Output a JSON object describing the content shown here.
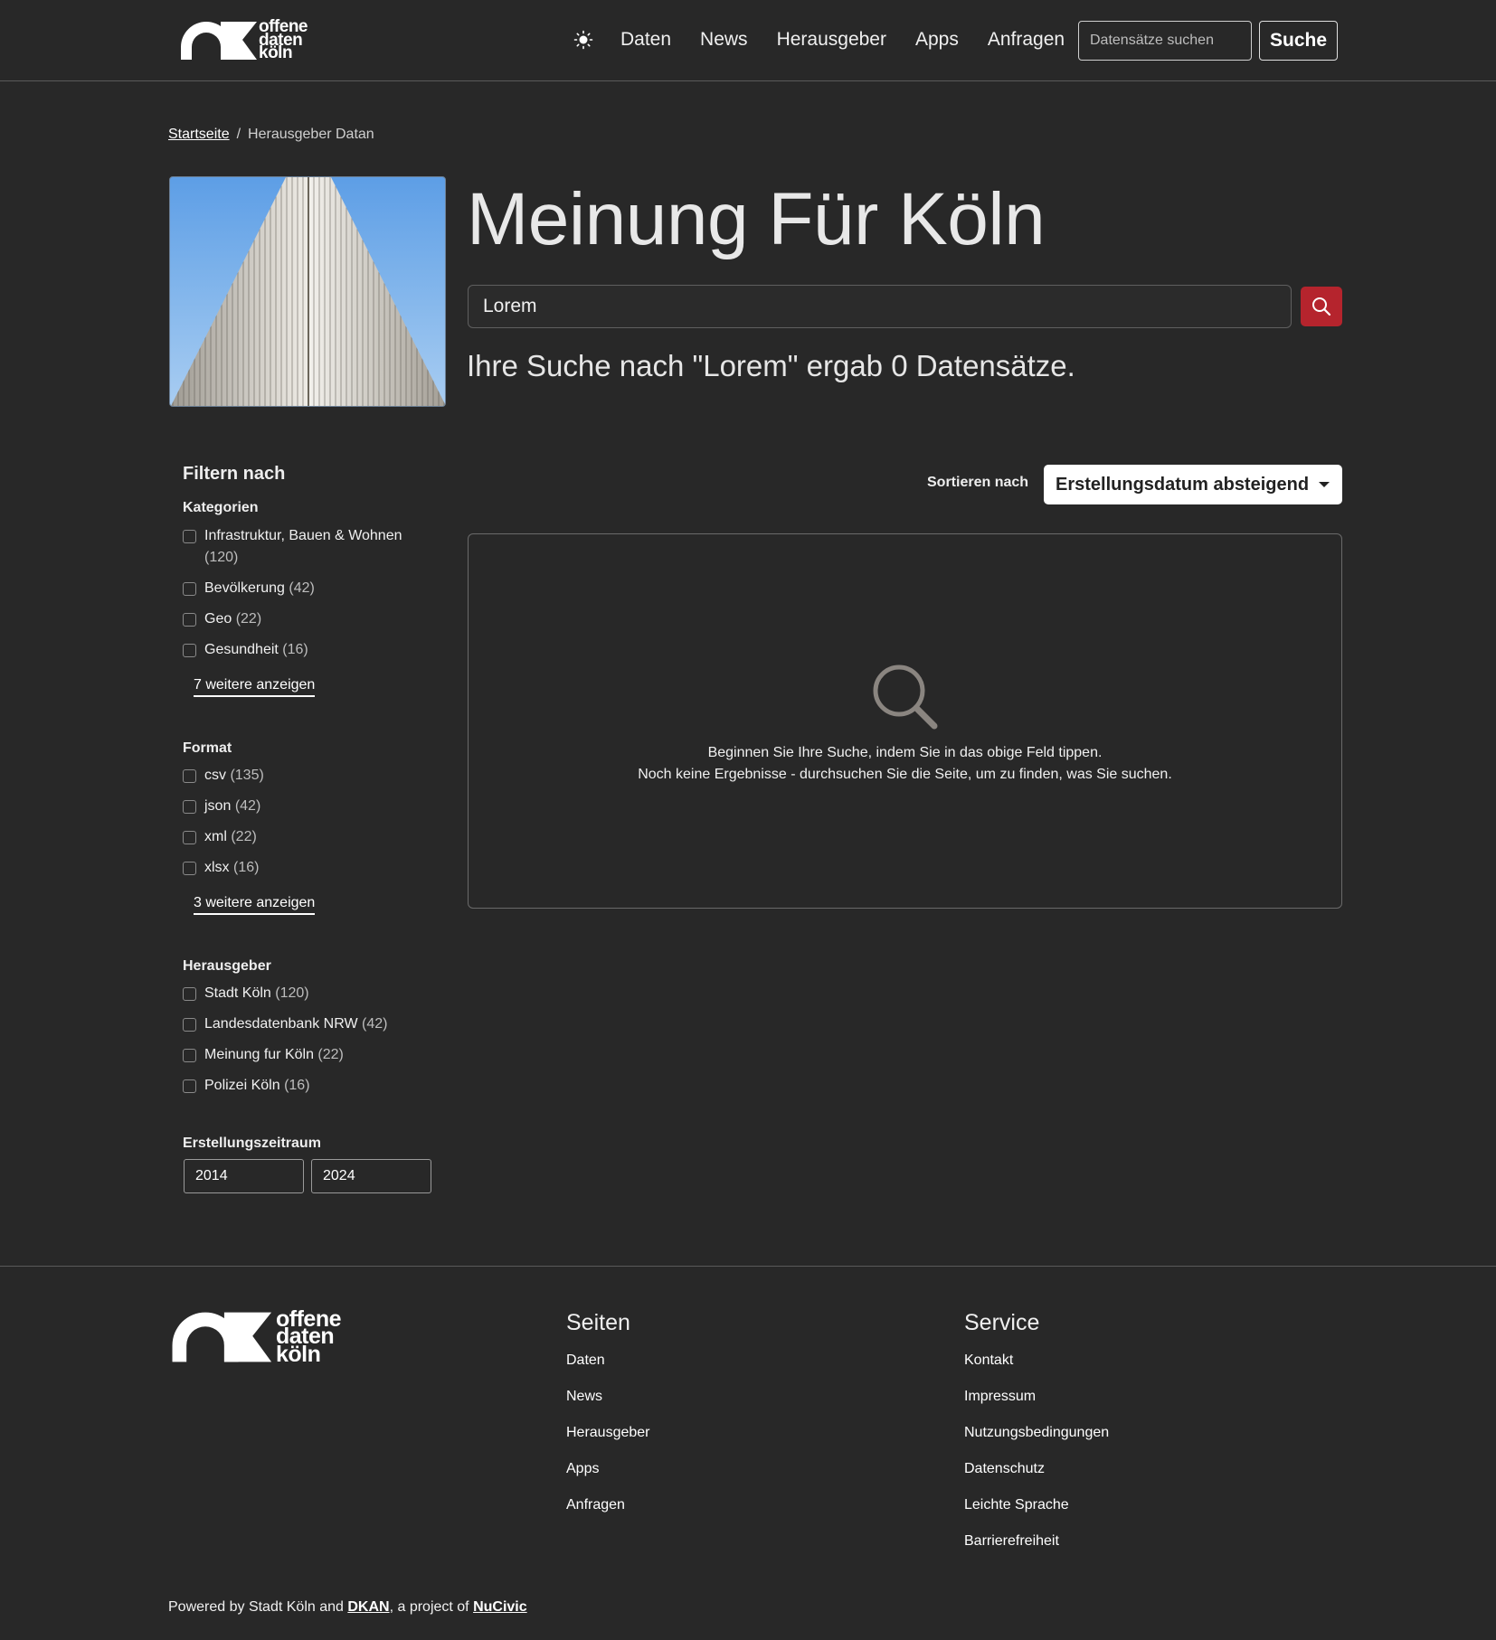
{
  "logo": {
    "line1": "offene",
    "line2": "daten",
    "line3": "köln"
  },
  "header": {
    "nav": [
      "Daten",
      "News",
      "Herausgeber",
      "Apps",
      "Anfragen"
    ],
    "search_placeholder": "Datensätze suchen",
    "search_button": "Suche"
  },
  "breadcrumb": {
    "home": "Startseite",
    "separator": "/",
    "current": "Herausgeber Datan"
  },
  "page": {
    "title": "Meinung Für Köln",
    "search_value": "Lorem",
    "result_text": "Ihre Suche nach \"Lorem\" ergab 0 Datensätze."
  },
  "filters": {
    "title": "Filtern nach",
    "groups": [
      {
        "title": "Kategorien",
        "items": [
          {
            "label": "Infrastruktur, Bauen & Wohnen",
            "count": "(120)"
          },
          {
            "label": "Bevölkerung",
            "count": "(42)"
          },
          {
            "label": "Geo",
            "count": "(22)"
          },
          {
            "label": "Gesundheit",
            "count": "(16)"
          }
        ],
        "more": "7 weitere anzeigen"
      },
      {
        "title": "Format",
        "items": [
          {
            "label": "csv",
            "count": "(135)"
          },
          {
            "label": "json",
            "count": "(42)"
          },
          {
            "label": "xml",
            "count": "(22)"
          },
          {
            "label": "xlsx",
            "count": "(16)"
          }
        ],
        "more": "3 weitere anzeigen"
      },
      {
        "title": "Herausgeber",
        "items": [
          {
            "label": "Stadt Köln",
            "count": "(120)"
          },
          {
            "label": "Landesdatenbank NRW",
            "count": "(42)"
          },
          {
            "label": "Meinung fur Köln",
            "count": "(22)"
          },
          {
            "label": "Polizei Köln",
            "count": "(16)"
          }
        ]
      }
    ],
    "period": {
      "title": "Erstellungszeitraum",
      "from": "2014",
      "to": "2024"
    }
  },
  "sort": {
    "label": "Sortieren nach",
    "value": "Erstellungsdatum absteigend"
  },
  "empty": {
    "line1": "Beginnen Sie Ihre Suche, indem Sie in das obige Feld tippen.",
    "line2": "Noch keine Ergebnisse - durchsuchen Sie die Seite, um zu finden, was Sie suchen."
  },
  "footer": {
    "seiten": {
      "title": "Seiten",
      "links": [
        "Daten",
        "News",
        "Herausgeber",
        "Apps",
        "Anfragen"
      ]
    },
    "service": {
      "title": "Service",
      "links": [
        "Kontakt",
        "Impressum",
        "Nutzungsbedingungen",
        "Datenschutz",
        "Leichte Sprache",
        "Barrierefreiheit"
      ]
    },
    "powered_prefix": "Powered by Stadt Köln and ",
    "dkan": "DKAN",
    "middle": ", a project of ",
    "nucivic": "NuCivic"
  },
  "colors": {
    "background": "#282828",
    "accent_red": "#b5242d",
    "text": "#e6e6e6"
  },
  "icons": [
    "logo-mark",
    "sun-icon",
    "search-icon",
    "magnifier-large-icon",
    "caret-down-icon"
  ]
}
